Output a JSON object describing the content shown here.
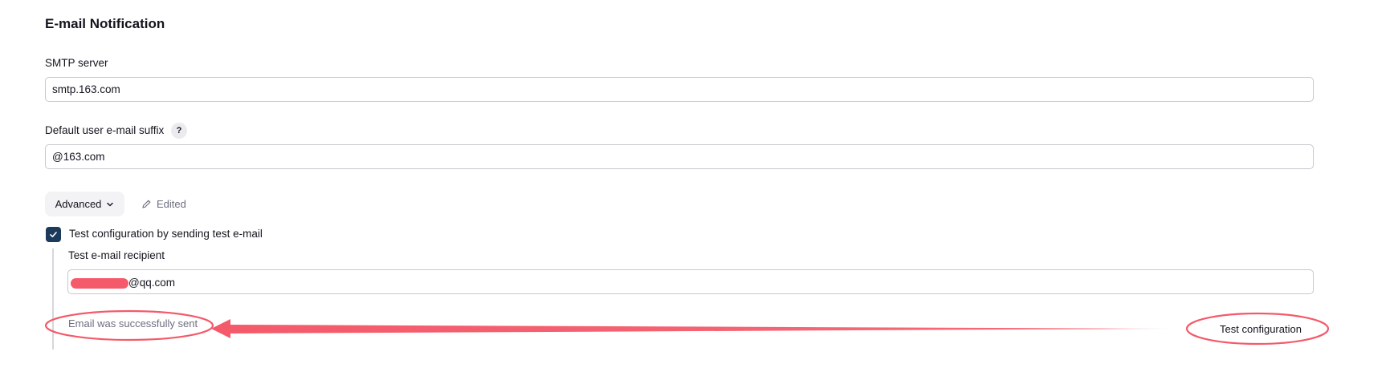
{
  "section": {
    "title": "E-mail Notification"
  },
  "smtp": {
    "label": "SMTP server",
    "value": "smtp.163.com"
  },
  "suffix": {
    "label": "Default user e-mail suffix",
    "help": "?",
    "value": "@163.com"
  },
  "advanced": {
    "label": "Advanced",
    "edited_label": "Edited"
  },
  "test": {
    "checkbox_label": "Test configuration by sending test e-mail",
    "checked": true,
    "recipient_label": "Test e-mail recipient",
    "recipient_value": "@qq.com",
    "status": "Email was successfully sent",
    "button_label": "Test configuration"
  },
  "colors": {
    "checkbox": "#1b3a5c",
    "annotation": "#f45a6a",
    "muted_text": "#6e6e80"
  },
  "icons": {
    "help": "question-mark-icon",
    "advanced": "chevron-down-icon",
    "edited": "pencil-icon",
    "checkbox": "checkmark-icon"
  }
}
